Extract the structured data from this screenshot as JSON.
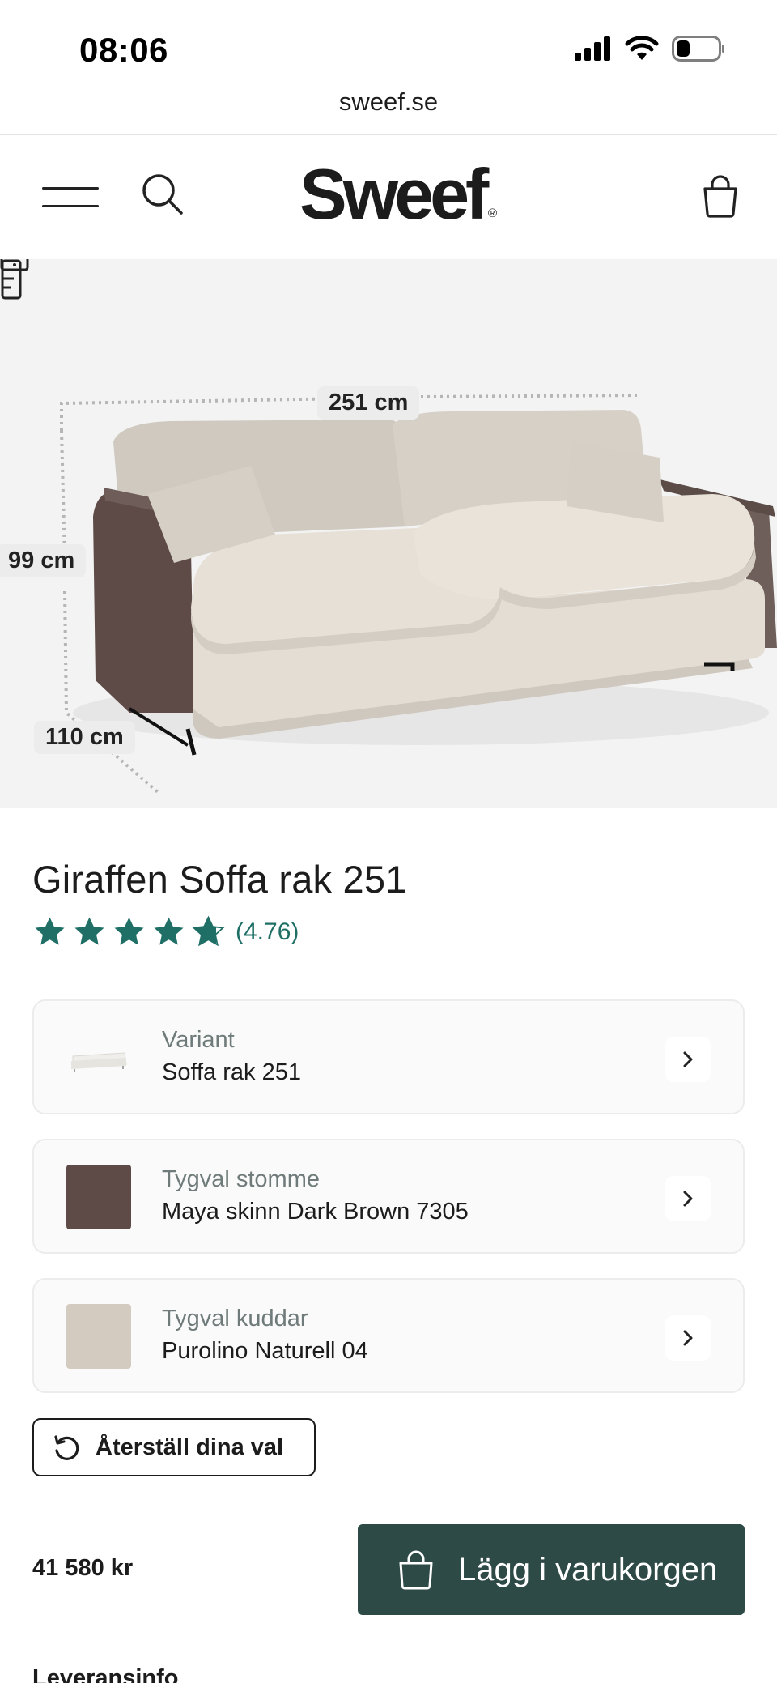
{
  "status_bar": {
    "time": "08:06"
  },
  "browser": {
    "url": "sweef.se"
  },
  "header": {
    "logo": "Sweef",
    "logo_mark": "®"
  },
  "hero": {
    "dimensions": {
      "width": "251 cm",
      "height": "99 cm",
      "depth": "110 cm"
    }
  },
  "product": {
    "title": "Giraffen Soffa rak 251",
    "rating": 4.76,
    "rating_text": "(4.76)",
    "options": [
      {
        "label": "Variant",
        "value": "Soffa rak 251",
        "swatch": "#efeeea"
      },
      {
        "label": "Tygval stomme",
        "value": "Maya skinn Dark Brown 7305",
        "swatch": "#5e4b47"
      },
      {
        "label": "Tygval kuddar",
        "value": "Purolino Naturell 04",
        "swatch": "#d4cbc0"
      }
    ],
    "reset_label": "Återställ dina val",
    "price": "41 580 kr",
    "add_to_cart_label": "Lägg i varukorgen",
    "delivery_heading": "Leveransinfo"
  },
  "colors": {
    "accent": "#2d4a47",
    "star": "#1f6f66",
    "frame_brown": "#5e4b47",
    "fabric_natural": "#d4cbc0"
  },
  "icons": [
    "hamburger-menu-icon",
    "search-icon",
    "shopping-bag-icon",
    "ruler-icon",
    "star-icon",
    "chevron-right-icon",
    "reset-icon",
    "signal-icon",
    "wifi-icon",
    "battery-icon"
  ]
}
